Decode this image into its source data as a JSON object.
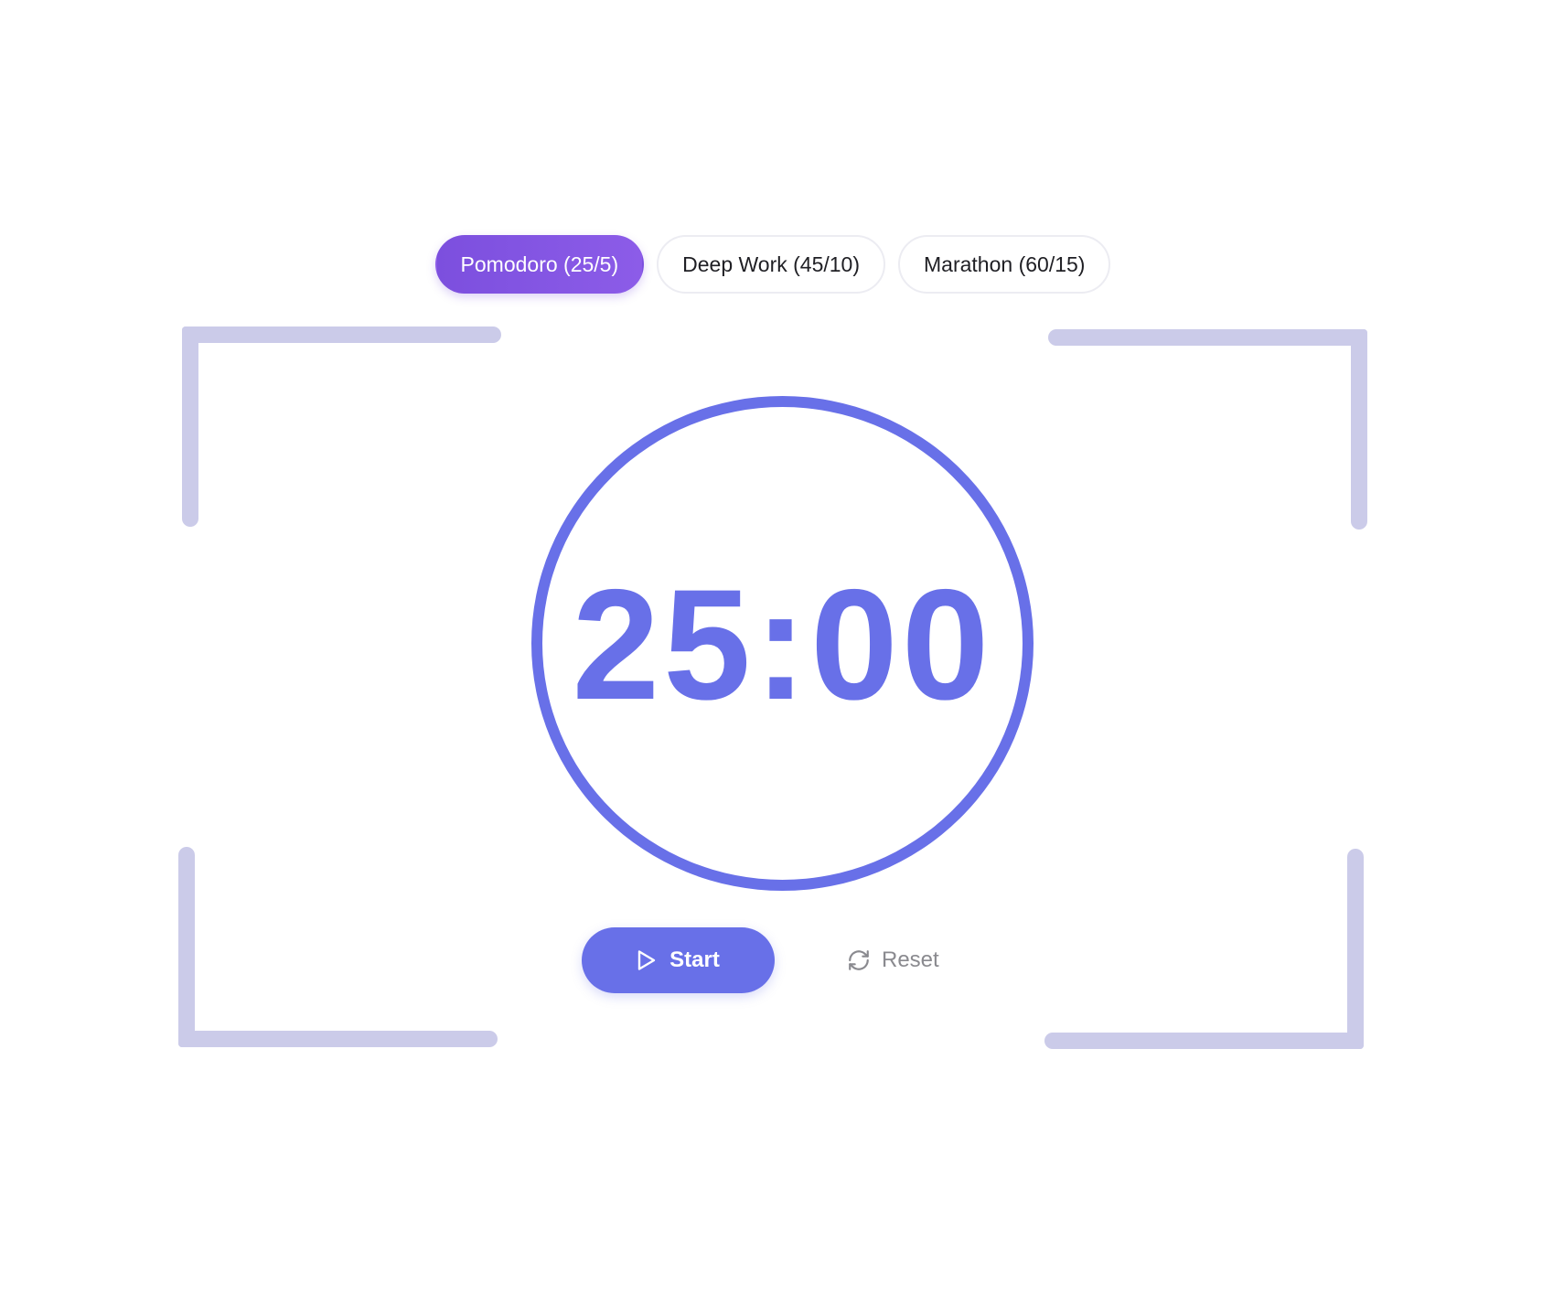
{
  "modes": [
    {
      "label": "Pomodoro (25/5)",
      "active": true
    },
    {
      "label": "Deep Work (45/10)",
      "active": false
    },
    {
      "label": "Marathon (60/15)",
      "active": false
    }
  ],
  "timer": {
    "display": "25:00"
  },
  "controls": {
    "start_label": "Start",
    "start_icon": "play-icon",
    "reset_label": "Reset",
    "reset_icon": "refresh-icon"
  },
  "colors": {
    "accent": "#6870e8",
    "active_tab": "#8258e4",
    "bracket": "#cbcbe9",
    "muted_text": "#8a8a8f"
  }
}
